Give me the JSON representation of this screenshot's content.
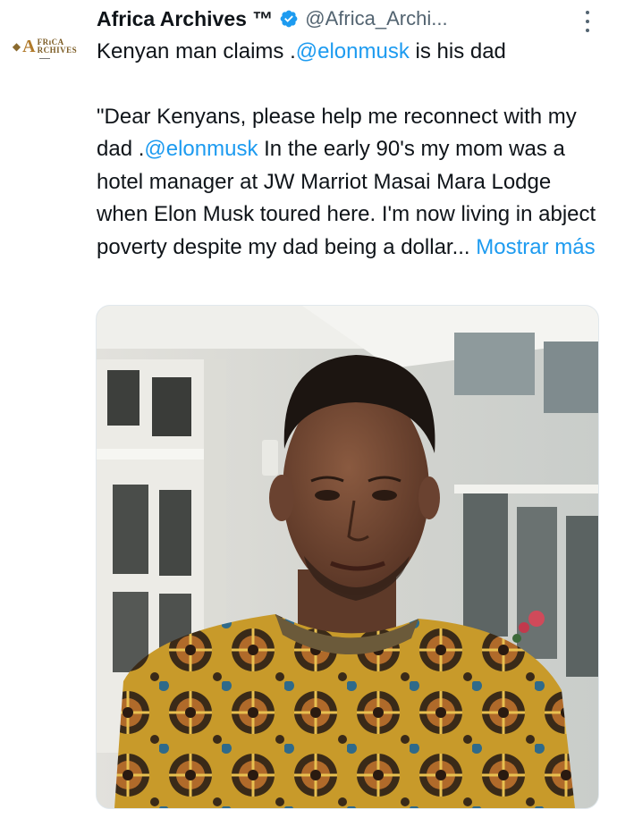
{
  "tweet": {
    "author_name": "Africa Archives ™",
    "author_handle": "@Africa_Archi...",
    "avatar_text": {
      "big": "A",
      "top": "FRıCA",
      "bottom": "RCHIVES"
    },
    "line1_prefix": "Kenyan man claims .",
    "line1_mention": "@elonmusk",
    "line1_suffix": " is his dad",
    "body_1": "\"Dear Kenyans, please help me reconnect with my dad .",
    "body_mention": "@elonmusk",
    "body_2": "  In the early 90's my mom was a hotel manager at JW Marriot Masai Mara Lodge when Elon Musk toured here. I'm now living in abject poverty despite my dad being a dollar...",
    "show_more": "Mostrar más"
  },
  "icons": {
    "verified": "verified-badge-icon",
    "more": "more-options-icon"
  },
  "colors": {
    "link": "#1d9bf0",
    "text": "#0f1419",
    "secondary": "#536471"
  }
}
